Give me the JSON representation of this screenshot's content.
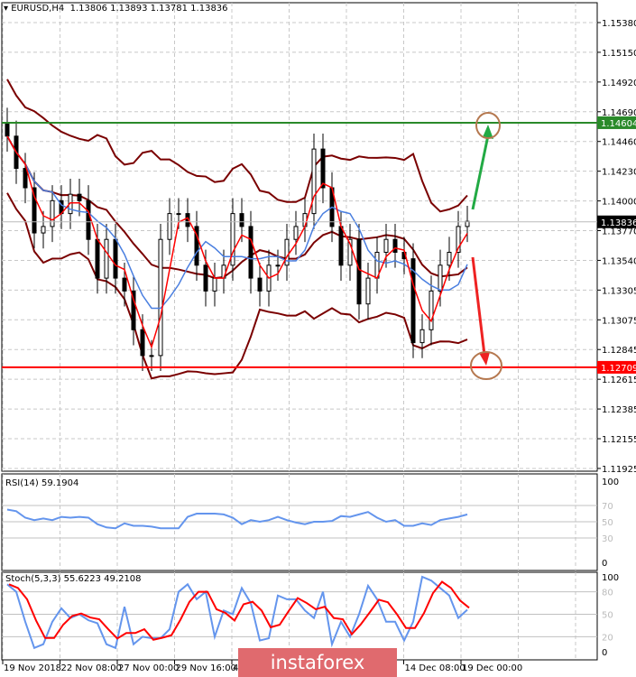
{
  "header": {
    "symbol": "EURUSD,H4",
    "ohlc": "1.13806 1.13893 1.13781 1.13836"
  },
  "price_axis": {
    "labels": [
      "1.15380",
      "1.15150",
      "1.14920",
      "1.14690",
      "1.14460",
      "1.14230",
      "1.14000",
      "1.13770",
      "1.13540",
      "1.13305",
      "1.13075",
      "1.12845",
      "1.12615",
      "1.12385",
      "1.12155",
      "1.11925"
    ],
    "current": "1.13836",
    "resistance": "1.14604",
    "support": "1.12709"
  },
  "colors": {
    "resistance": "#2a8a2a",
    "support": "#ff0000",
    "current_bg": "#000000",
    "band": "#7a0000",
    "fast_ma": "#ff0000",
    "slow_ma": "#4a7fe0",
    "rsi": "#6495ed",
    "stoch_k": "#6495ed",
    "stoch_d": "#ff0000",
    "circle": "#b5784f"
  },
  "rsi": {
    "label": "RSI(14) 59.1904",
    "axis": [
      "100",
      "70",
      "50",
      "30",
      "0"
    ]
  },
  "stoch": {
    "label": "Stoch(5,3,3) 55.6223 49.2108",
    "axis": [
      "100",
      "80",
      "50",
      "20",
      "0"
    ]
  },
  "time_axis": [
    "19 Nov 2018",
    "22 Nov 08:00",
    "27 Nov 00:00",
    "29 Nov 16:00",
    "4 Dec 08:00",
    "",
    "",
    "14 Dec 08:00",
    "19 Dec 00:00"
  ],
  "watermark": "instaforex",
  "chart_data": {
    "type": "candlestick",
    "closes": [
      1.145,
      1.1425,
      1.141,
      1.1375,
      1.138,
      1.14,
      1.139,
      1.1405,
      1.14,
      1.137,
      1.134,
      1.137,
      1.134,
      1.133,
      1.13,
      1.128,
      1.128,
      1.137,
      1.139,
      1.139,
      1.138,
      1.135,
      1.133,
      1.134,
      1.135,
      1.139,
      1.138,
      1.134,
      1.133,
      1.135,
      1.135,
      1.137,
      1.138,
      1.139,
      1.144,
      1.141,
      1.138,
      1.135,
      1.137,
      1.132,
      1.134,
      1.136,
      1.137,
      1.136,
      1.1355,
      1.129,
      1.13,
      1.133,
      1.135,
      1.136,
      1.138,
      1.1384
    ],
    "rsi_values": [
      65,
      63,
      55,
      52,
      54,
      52,
      56,
      55,
      56,
      55,
      47,
      43,
      42,
      48,
      45,
      45,
      44,
      42,
      42,
      42,
      56,
      60,
      60,
      60,
      59,
      55,
      47,
      52,
      50,
      52,
      56,
      52,
      49,
      47,
      50,
      50,
      51,
      57,
      56,
      59,
      62,
      55,
      50,
      52,
      45,
      45,
      48,
      46,
      52,
      54,
      56,
      59
    ],
    "stoch_k": [
      90,
      80,
      40,
      5,
      10,
      40,
      58,
      45,
      50,
      42,
      38,
      10,
      5,
      60,
      10,
      20,
      18,
      18,
      30,
      80,
      90,
      70,
      80,
      20,
      55,
      50,
      85,
      65,
      15,
      18,
      75,
      70,
      70,
      55,
      45,
      80,
      10,
      40,
      20,
      50,
      88,
      70,
      40,
      40,
      15,
      40,
      100,
      95,
      85,
      75,
      45,
      56
    ],
    "ylim": [
      1.11925,
      1.1538
    ]
  }
}
